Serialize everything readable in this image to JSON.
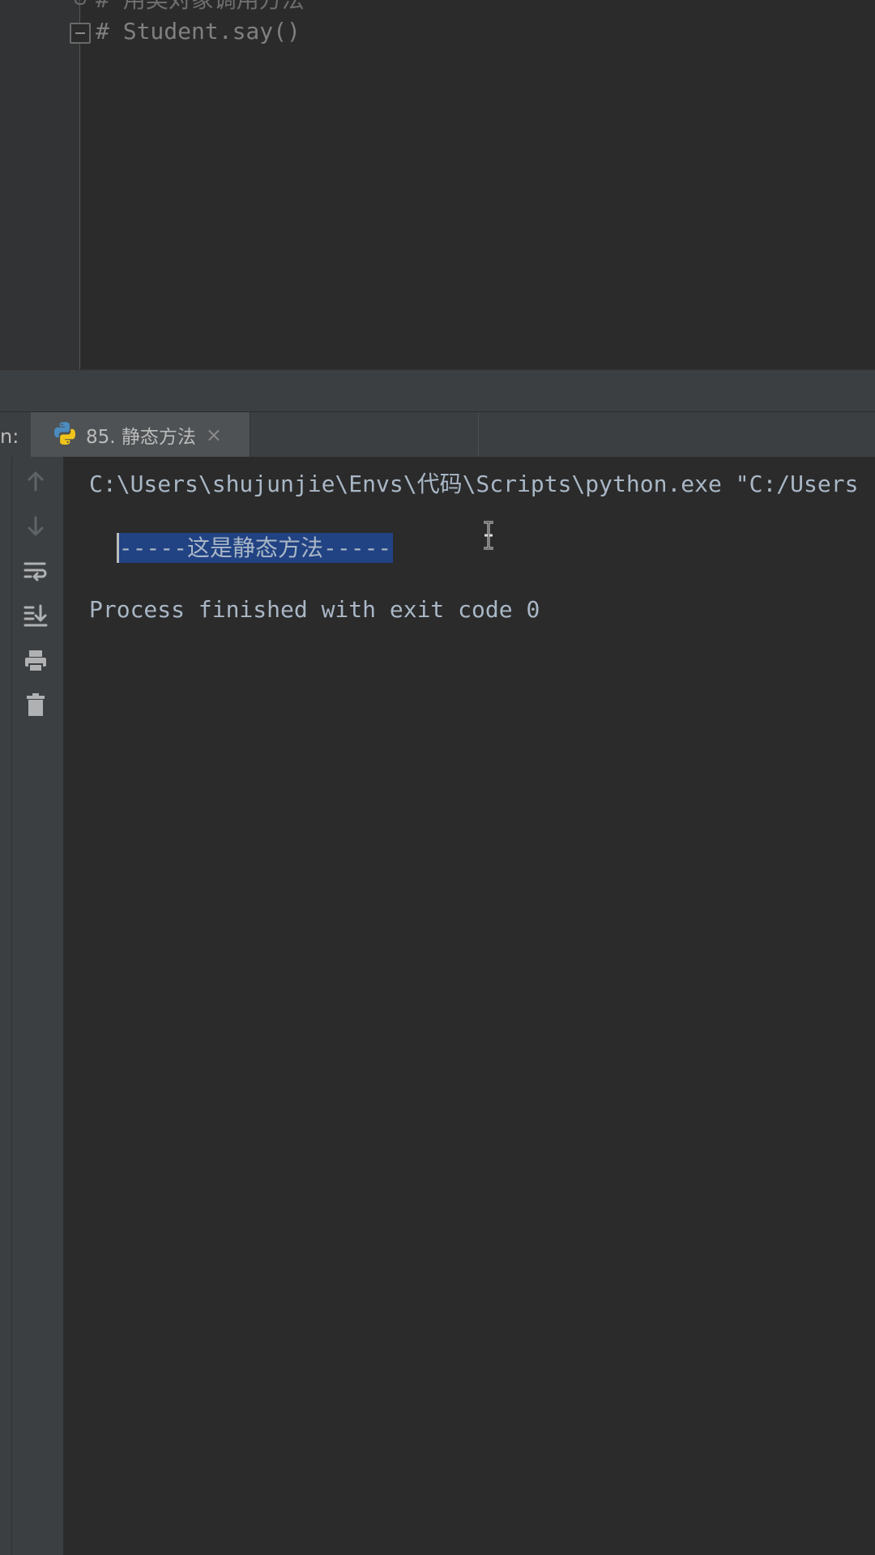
{
  "editor": {
    "partial_line": "# 用类对象调用方法",
    "code_line": "# Student.say()"
  },
  "run_panel": {
    "label": "n:",
    "tab_title": "85. 静态方法",
    "tab_close": "×"
  },
  "console": {
    "lines": [
      "C:\\Users\\shujunjie\\Envs\\代码\\Scripts\\python.exe \"C:/Users",
      "-----这是静态方法-----",
      "",
      "Process finished with exit code 0"
    ]
  },
  "icons": {
    "toolbar": [
      "arrow-up-icon",
      "arrow-down-icon",
      "soft-wrap-icon",
      "scroll-to-end-icon",
      "print-icon",
      "trash-icon"
    ],
    "tab": "python-icon"
  },
  "colors": {
    "background": "#2b2b2b",
    "panel": "#3c3f41",
    "selection": "#214283",
    "text": "#a9b7c6"
  }
}
